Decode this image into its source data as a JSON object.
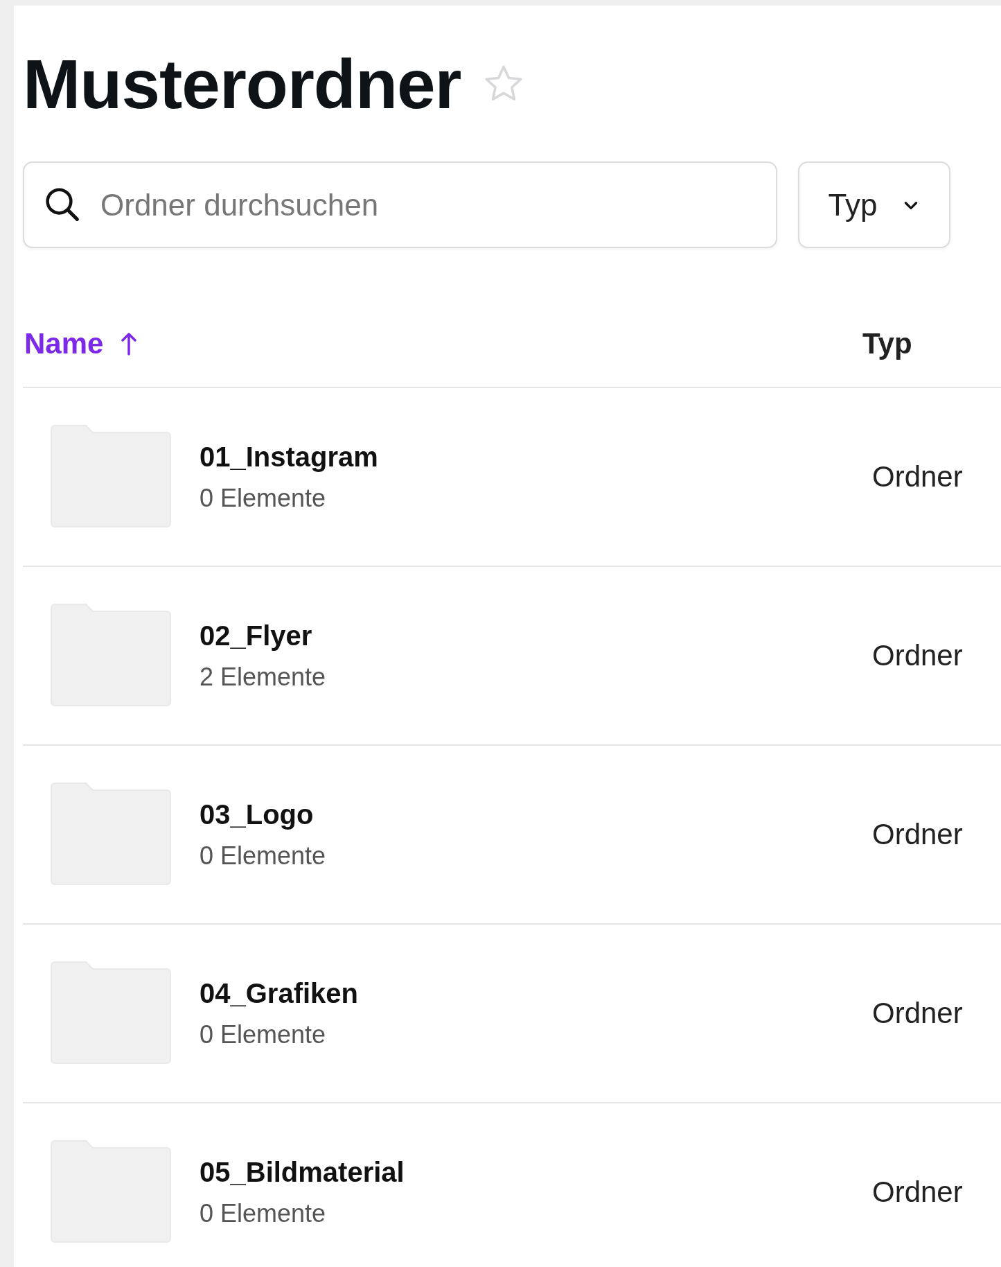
{
  "title": "Musterordner",
  "starred": false,
  "search": {
    "placeholder": "Ordner durchsuchen"
  },
  "type_filter": {
    "label": "Typ"
  },
  "columns": [
    {
      "label": "Name",
      "sorted": true
    },
    {
      "label": "Typ",
      "sorted": false
    }
  ],
  "rows": [
    {
      "name": "01_Instagram",
      "count": "0 Elemente",
      "type": "Ordner"
    },
    {
      "name": "02_Flyer",
      "count": "2 Elemente",
      "type": "Ordner"
    },
    {
      "name": "03_Logo",
      "count": "0 Elemente",
      "type": "Ordner"
    },
    {
      "name": "04_Grafiken",
      "count": "0 Elemente",
      "type": "Ordner"
    },
    {
      "name": "05_Bildmaterial",
      "count": "0 Elemente",
      "type": "Ordner"
    }
  ]
}
